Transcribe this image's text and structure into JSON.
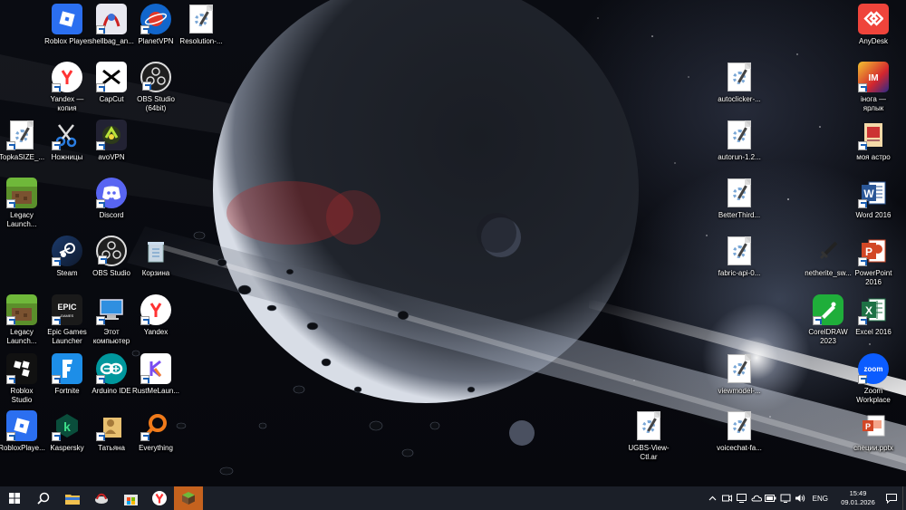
{
  "desktop": {
    "icons": [
      {
        "label": "Roblox Player",
        "icon": "roblox-player-icon"
      },
      {
        "label": "shellbag_an...",
        "icon": "shellbag-icon"
      },
      {
        "label": "PlanetVPN",
        "icon": "planetvpn-icon"
      },
      {
        "label": "Resolution-...",
        "icon": "script-file-icon"
      },
      {
        "label": "Yandex —\nкопия",
        "icon": "yandex-browser-icon"
      },
      {
        "label": "CapCut",
        "icon": "capcut-icon"
      },
      {
        "label": "OBS Studio\n(64bit)",
        "icon": "obs-studio-icon"
      },
      {
        "label": "TopkaSIZE_...",
        "icon": "script-file-icon"
      },
      {
        "label": "Ножницы",
        "icon": "snipping-tool-icon"
      },
      {
        "label": "avoVPN",
        "icon": "avovpn-icon"
      },
      {
        "label": "Legacy\nLaunch...",
        "icon": "minecraft-legacy-icon"
      },
      {
        "label": "Discord",
        "icon": "discord-icon"
      },
      {
        "label": "Steam",
        "icon": "steam-icon"
      },
      {
        "label": "OBS Studio",
        "icon": "obs-studio-icon"
      },
      {
        "label": "Корзина",
        "icon": "recycle-bin-icon"
      },
      {
        "label": "Legacy\nLaunch...",
        "icon": "minecraft-legacy-icon"
      },
      {
        "label": "Epic Games\nLauncher",
        "icon": "epic-games-icon"
      },
      {
        "label": "Этот\nкомпьютер",
        "icon": "this-pc-icon"
      },
      {
        "label": "Yandex",
        "icon": "yandex-browser-icon"
      },
      {
        "label": "Roblox\nStudio",
        "icon": "roblox-studio-icon"
      },
      {
        "label": "Fortnite",
        "icon": "fortnite-icon"
      },
      {
        "label": "Arduino IDE",
        "icon": "arduino-icon"
      },
      {
        "label": "RustMeLaun...",
        "icon": "rustme-icon"
      },
      {
        "label": "RobloxPlaye...",
        "icon": "roblox-player-icon"
      },
      {
        "label": "Kaspersky",
        "icon": "kaspersky-icon"
      },
      {
        "label": "Татьяна",
        "icon": "user-folder-icon"
      },
      {
        "label": "Everything",
        "icon": "everything-search-icon"
      },
      {
        "label": "autoclicker-...",
        "icon": "script-file-icon"
      },
      {
        "label": "autorun-1.2...",
        "icon": "script-file-icon"
      },
      {
        "label": "BetterThird...",
        "icon": "script-file-icon"
      },
      {
        "label": "fabric-api-0...",
        "icon": "script-file-icon"
      },
      {
        "label": "viewmodel-...",
        "icon": "script-file-icon"
      },
      {
        "label": "voicechat-fa...",
        "icon": "script-file-icon"
      },
      {
        "label": "netherite_sw...",
        "icon": "netherite-sword-icon"
      },
      {
        "label": "CorelDRAW\n2023",
        "icon": "coreldraw-icon"
      },
      {
        "label": "UGBS-View-\nCtl.ar",
        "icon": "script-file-icon"
      },
      {
        "label": "AnyDesk",
        "icon": "anydesk-icon"
      },
      {
        "label": "інога —\nярлык",
        "icon": "game-shortcut-icon"
      },
      {
        "label": "моя астро",
        "icon": "pdf-document-icon"
      },
      {
        "label": "Word 2016",
        "icon": "word-icon"
      },
      {
        "label": "PowerPoint\n2016",
        "icon": "powerpoint-icon"
      },
      {
        "label": "Excel 2016",
        "icon": "excel-icon"
      },
      {
        "label": "Zoom\nWorkplace",
        "icon": "zoom-icon"
      },
      {
        "label": "специи.pptx",
        "icon": "pptx-file-icon"
      }
    ]
  },
  "taskbar": {
    "buttons": [
      "start-icon",
      "search-icon",
      "file-explorer-icon",
      "shellbag-icon",
      "microsoft-store-icon",
      "yandex-browser-icon",
      "minecraft-icon"
    ],
    "tray": {
      "language": "ENG",
      "time": "15:49",
      "date": "09.01.2026"
    }
  }
}
